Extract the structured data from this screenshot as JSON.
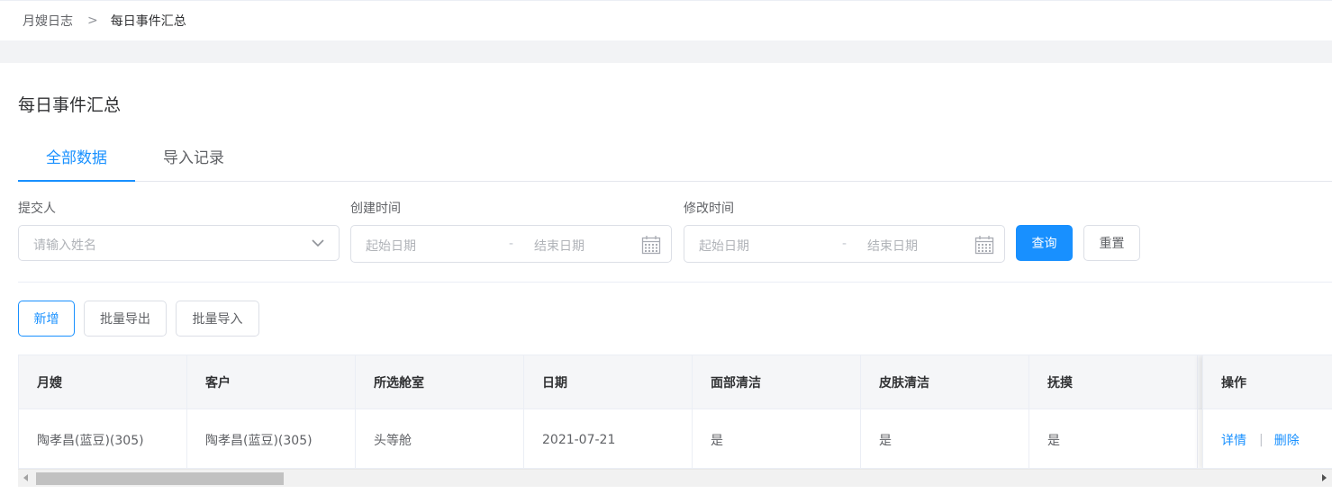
{
  "breadcrumb": {
    "parent": "月嫂日志",
    "separator": ">",
    "current": "每日事件汇总"
  },
  "page_title": "每日事件汇总",
  "tabs": [
    {
      "label": "全部数据",
      "active": true
    },
    {
      "label": "导入记录",
      "active": false
    }
  ],
  "filters": {
    "submitter": {
      "label": "提交人",
      "placeholder": "请输入姓名"
    },
    "created_time": {
      "label": "创建时间",
      "start_placeholder": "起始日期",
      "separator": "-",
      "end_placeholder": "结束日期"
    },
    "modified_time": {
      "label": "修改时间",
      "start_placeholder": "起始日期",
      "separator": "-",
      "end_placeholder": "结束日期"
    },
    "query_button": "查询",
    "reset_button": "重置"
  },
  "actions": {
    "add": "新增",
    "batch_export": "批量导出",
    "batch_import": "批量导入"
  },
  "table": {
    "columns": [
      "月嫂",
      "客户",
      "所选舱室",
      "日期",
      "面部清洁",
      "皮肤清洁",
      "抚摸"
    ],
    "op_column": "操作",
    "rows": [
      {
        "cells": [
          "陶孝昌(蓝豆)(305)",
          "陶孝昌(蓝豆)(305)",
          "头等舱",
          "2021-07-21",
          "是",
          "是",
          "是"
        ],
        "detail": "详情",
        "separator": "|",
        "delete": "删除"
      }
    ]
  },
  "colors": {
    "primary": "#1890ff",
    "header_bg": "#f5f6f8",
    "band_bg": "#f2f3f5"
  }
}
